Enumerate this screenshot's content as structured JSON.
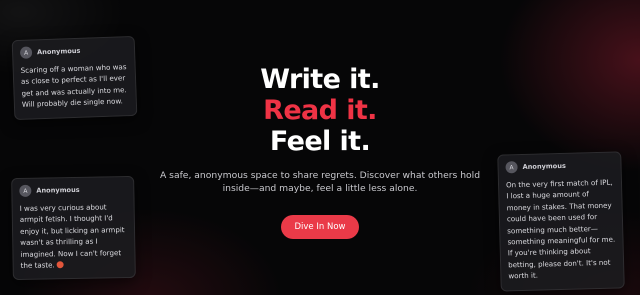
{
  "hero": {
    "line1": "Write it.",
    "line2": "Read it.",
    "line3": "Feel it.",
    "subtitle": "A safe, anonymous space to share regrets. Discover what others hold inside—and maybe, feel a little less alone.",
    "cta_label": "Dive In Now"
  },
  "cards": [
    {
      "avatar": "A",
      "author": "Anonymous",
      "text": "Scaring off a woman who was as close to perfect as I'll ever get and was actually into me. Will probably die single now."
    },
    {
      "avatar": "A",
      "author": "Anonymous",
      "text": "I was very curious about armpit fetish. I thought I'd enjoy it, but licking an armpit wasn't as thrilling as I imagined. Now I can't forget the taste.",
      "emoji_icon": "face-emoji-icon"
    },
    {
      "avatar": "A",
      "author": "Anonymous",
      "text": "On the very first match of IPL, I lost a huge amount of money in stakes. That money could have been used for something much better—something meaningful for me. If you're thinking about betting, please don't. It's not worth it."
    }
  ],
  "colors": {
    "background": "#050506",
    "accent_red": "#ef3345",
    "button": "#ea3a48",
    "card_bg": "#1c1c20"
  }
}
